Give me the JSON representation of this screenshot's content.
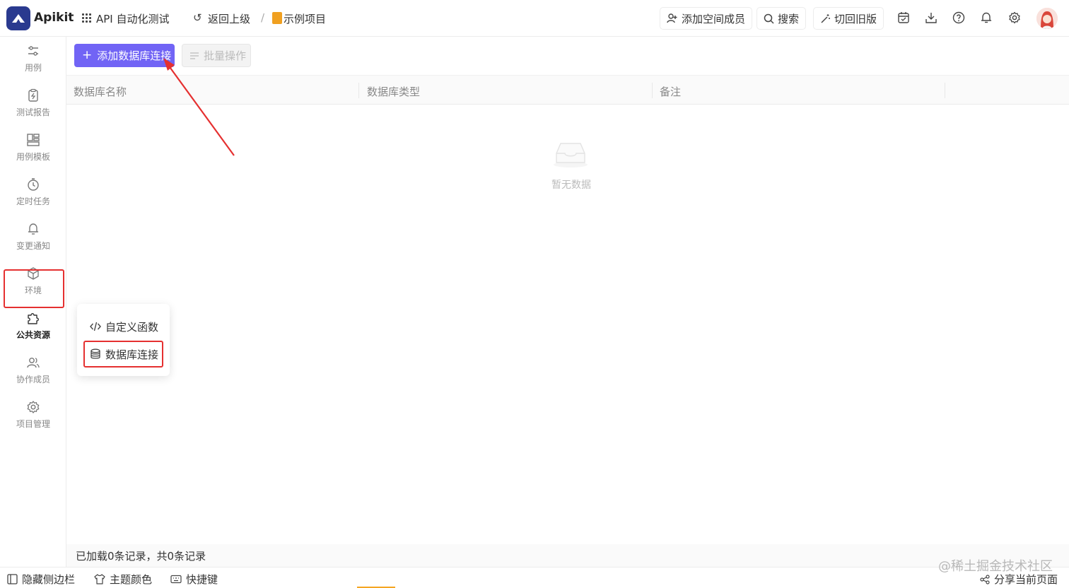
{
  "app": {
    "brand": "Apikit"
  },
  "header": {
    "workspace": "API 自动化测试",
    "back_label": "返回上级",
    "separator": "/",
    "project": "示例项目",
    "add_member": "添加空间成员",
    "search": "搜索",
    "switch_old": "切回旧版"
  },
  "sidebar": {
    "items": [
      {
        "label": "用例",
        "icon": "sliders-icon"
      },
      {
        "label": "测试报告",
        "icon": "report-icon"
      },
      {
        "label": "用例模板",
        "icon": "template-icon"
      },
      {
        "label": "定时任务",
        "icon": "timer-icon"
      },
      {
        "label": "变更通知",
        "icon": "bell-icon"
      },
      {
        "label": "环境",
        "icon": "cube-icon"
      },
      {
        "label": "公共资源",
        "icon": "puzzle-icon",
        "active": true
      },
      {
        "label": "协作成员",
        "icon": "users-icon"
      },
      {
        "label": "项目管理",
        "icon": "gear-icon"
      }
    ]
  },
  "toolbar": {
    "add_label": "添加数据库连接",
    "batch_label": "批量操作"
  },
  "table": {
    "columns": [
      "数据库名称",
      "数据库类型",
      "备注"
    ],
    "empty_text": "暂无数据"
  },
  "popover": {
    "items": [
      "自定义函数",
      "数据库连接"
    ]
  },
  "footer": {
    "records": "已加载0条记录，共0条记录",
    "hide_sidebar": "隐藏侧边栏",
    "theme": "主题颜色",
    "shortcuts": "快捷键",
    "share": "分享当前页面",
    "watermark": "@稀土掘金技术社区"
  },
  "colors": {
    "primary": "#7164f5",
    "highlight": "#e53030",
    "brand": "#2a3a8f"
  }
}
